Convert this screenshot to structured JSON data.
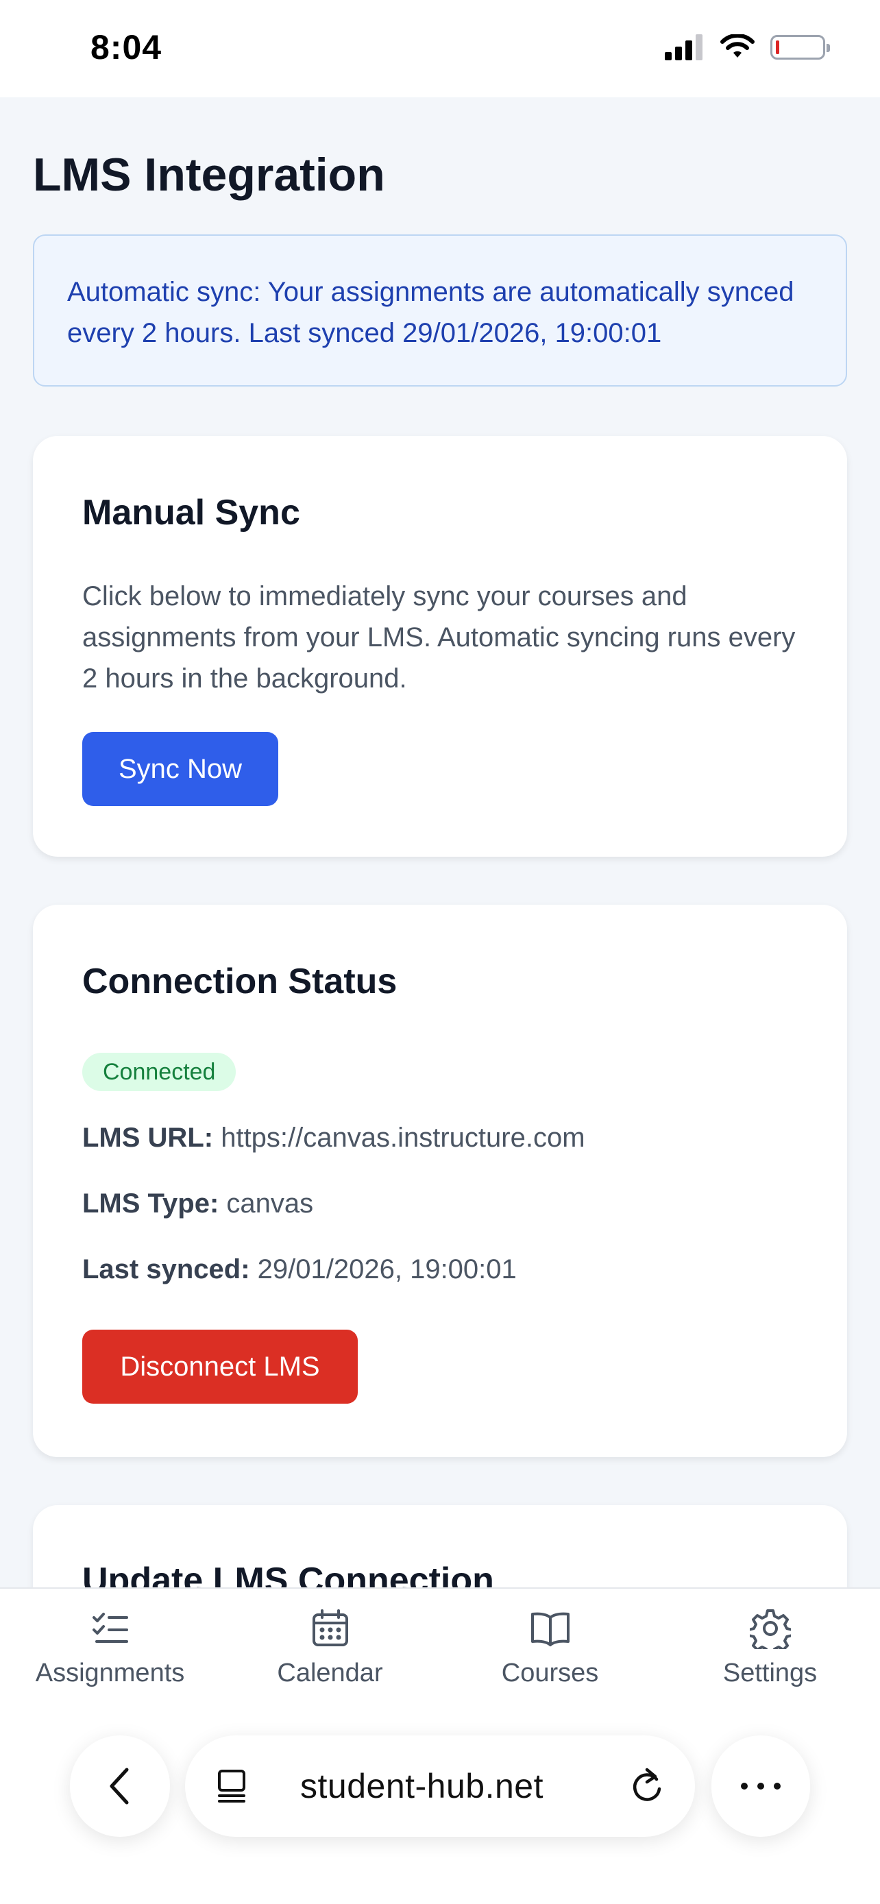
{
  "status_bar": {
    "time": "8:04"
  },
  "page": {
    "title": "LMS Integration"
  },
  "info_banner": {
    "text": "Automatic sync: Your assignments are automatically synced every 2 hours. Last synced 29/01/2026, 19:00:01"
  },
  "manual_sync": {
    "title": "Manual Sync",
    "description": "Click below to immediately sync your courses and assignments from your LMS. Automatic syncing runs every 2 hours in the background.",
    "button_label": "Sync Now"
  },
  "connection_status": {
    "title": "Connection Status",
    "badge": "Connected",
    "lms_url_label": "LMS URL:",
    "lms_url_value": "https://canvas.instructure.com",
    "lms_type_label": "LMS Type:",
    "lms_type_value": "canvas",
    "last_synced_label": "Last synced:",
    "last_synced_value": "29/01/2026, 19:00:01",
    "button_label": "Disconnect LMS"
  },
  "update_connection": {
    "title": "Update LMS Connection"
  },
  "tabbar": {
    "items": [
      {
        "label": "Assignments",
        "icon": "checklist-icon"
      },
      {
        "label": "Calendar",
        "icon": "calendar-icon"
      },
      {
        "label": "Courses",
        "icon": "book-icon"
      },
      {
        "label": "Settings",
        "icon": "gear-icon"
      }
    ]
  },
  "browser": {
    "url": "student-hub.net"
  },
  "colors": {
    "primary_blue": "#2f5eea",
    "danger_red": "#db2f24",
    "info_bg": "#eff5fe",
    "success_bg": "#dcfce7",
    "success_text": "#15803d"
  }
}
